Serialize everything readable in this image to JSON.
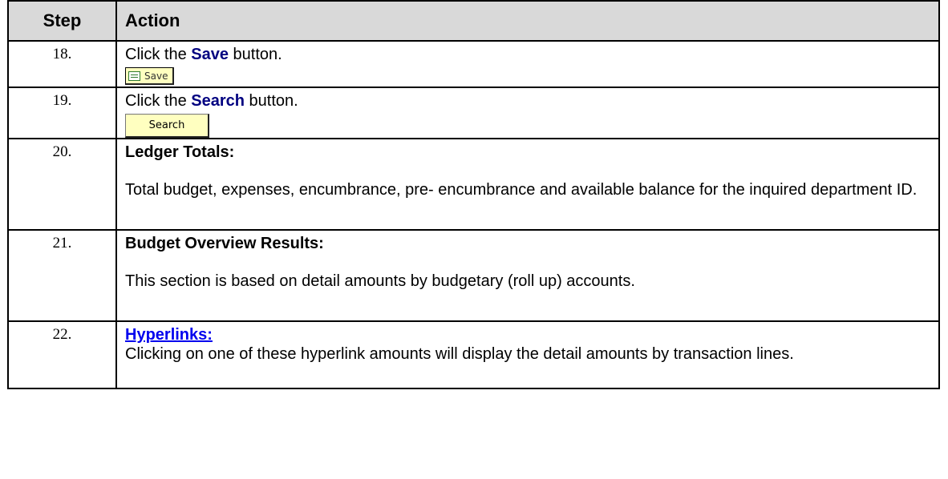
{
  "header": {
    "step": "Step",
    "action": "Action"
  },
  "rows": [
    {
      "step": "18.",
      "pre": "Click the ",
      "highlight": "Save",
      "post": " button.",
      "button_label": "Save"
    },
    {
      "step": "19.",
      "pre": "Click the ",
      "highlight": "Search",
      "post": " button.",
      "button_label": "Search"
    },
    {
      "step": "20.",
      "heading": "Ledger Totals:",
      "body": "Total budget, expenses, encumbrance, pre- encumbrance and available balance for the inquired department ID."
    },
    {
      "step": "21.",
      "heading": "Budget Overview Results:",
      "body": "This section is based on detail amounts by budgetary (roll up) accounts."
    },
    {
      "step": "22.",
      "heading": "Hyperlinks:",
      "body": "Clicking on one of these hyperlink amounts will display the detail amounts by transaction lines."
    }
  ],
  "colors": {
    "header_bg": "#d9d9d9",
    "highlight": "#000080",
    "link": "#0000ee",
    "button_bg": "#ffffc0"
  },
  "icons": {
    "save": "save-icon"
  }
}
